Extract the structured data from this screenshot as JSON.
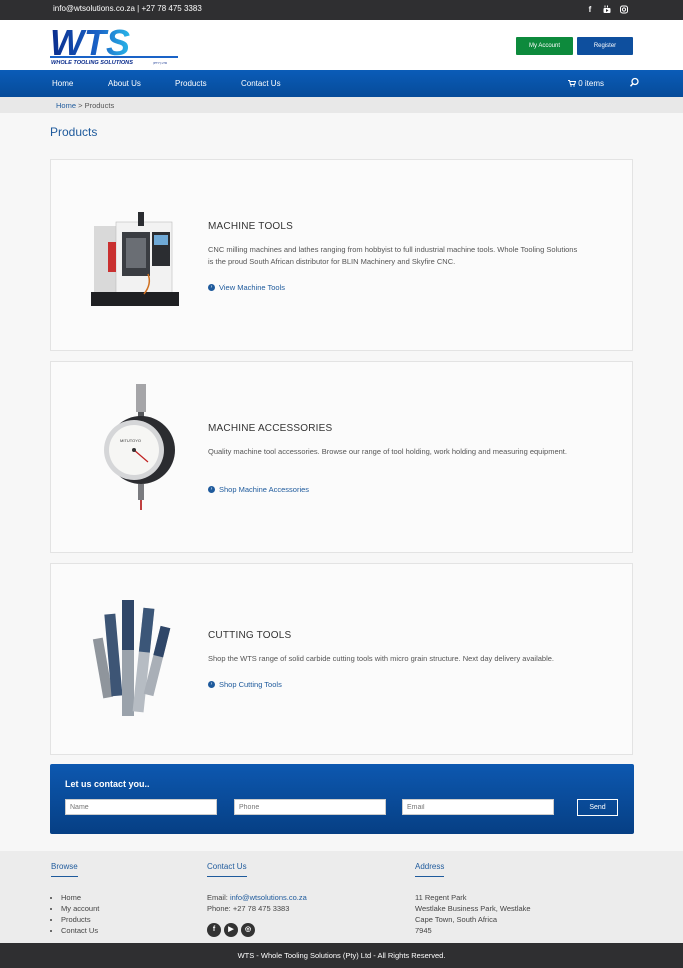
{
  "topbar": {
    "email": "info@wtsolutions.co.za",
    "separator": "|",
    "phone": "+27 78 475 3383",
    "socials": [
      "facebook-icon",
      "youtube-icon",
      "instagram-icon"
    ]
  },
  "header": {
    "logo_text": "WTS",
    "logo_tagline": "WHOLE TOOLING SOLUTIONS",
    "logo_suffix": "(PTY) LTD",
    "my_account": "My Account",
    "register": "Register"
  },
  "nav": {
    "items": [
      "Home",
      "About Us",
      "Products",
      "Contact Us"
    ],
    "cart": "0 items",
    "search_icon": "search-icon"
  },
  "breadcrumb": {
    "home": "Home",
    "separator": ">",
    "current": "Products"
  },
  "page_title": "Products",
  "products": [
    {
      "title": "MACHINE TOOLS",
      "description": "CNC milling machines and lathes ranging from hobbyist to full industrial machine tools. Whole Tooling Solutions is the proud South African distributor for BLIN Machinery and Skyfire CNC.",
      "link": "View Machine Tools",
      "icon": "cnc-machine-icon"
    },
    {
      "title": "MACHINE ACCESSORIES",
      "description": "Quality machine tool accessories. Browse our range of tool holding, work holding and measuring equipment.",
      "link": "Shop Machine Accessories",
      "icon": "dial-gauge-icon"
    },
    {
      "title": "CUTTING TOOLS",
      "description": "Shop the WTS range of solid carbide cutting tools with micro grain structure. Next day delivery available.",
      "link": "Shop Cutting Tools",
      "icon": "end-mill-icon"
    }
  ],
  "contact_form": {
    "heading": "Let us contact you..",
    "name_placeholder": "Name",
    "phone_placeholder": "Phone",
    "email_placeholder": "Email",
    "send": "Send"
  },
  "footer": {
    "browse": {
      "heading": "Browse",
      "items": [
        "Home",
        "My account",
        "Products",
        "Contact Us"
      ]
    },
    "contact": {
      "heading": "Contact Us",
      "email_label": "Email:",
      "email": "info@wtsolutions.co.za",
      "phone_label": "Phone:",
      "phone": "+27 78 475 3383",
      "socials": [
        "facebook-icon",
        "youtube-icon",
        "instagram-icon"
      ]
    },
    "address": {
      "heading": "Address",
      "lines": [
        "11 Regent Park",
        "Westlake Business Park, Westlake",
        "Cape Town, South Africa",
        "7945"
      ]
    },
    "copyright": "WTS - Whole Tooling Solutions (Pty) Ltd - All Rights Reserved."
  },
  "colors": {
    "brand_blue": "#0e4f9e",
    "nav_blue": "#0b5cb8",
    "account_green": "#0d8a3c",
    "dark_bar": "#2f2f31"
  }
}
